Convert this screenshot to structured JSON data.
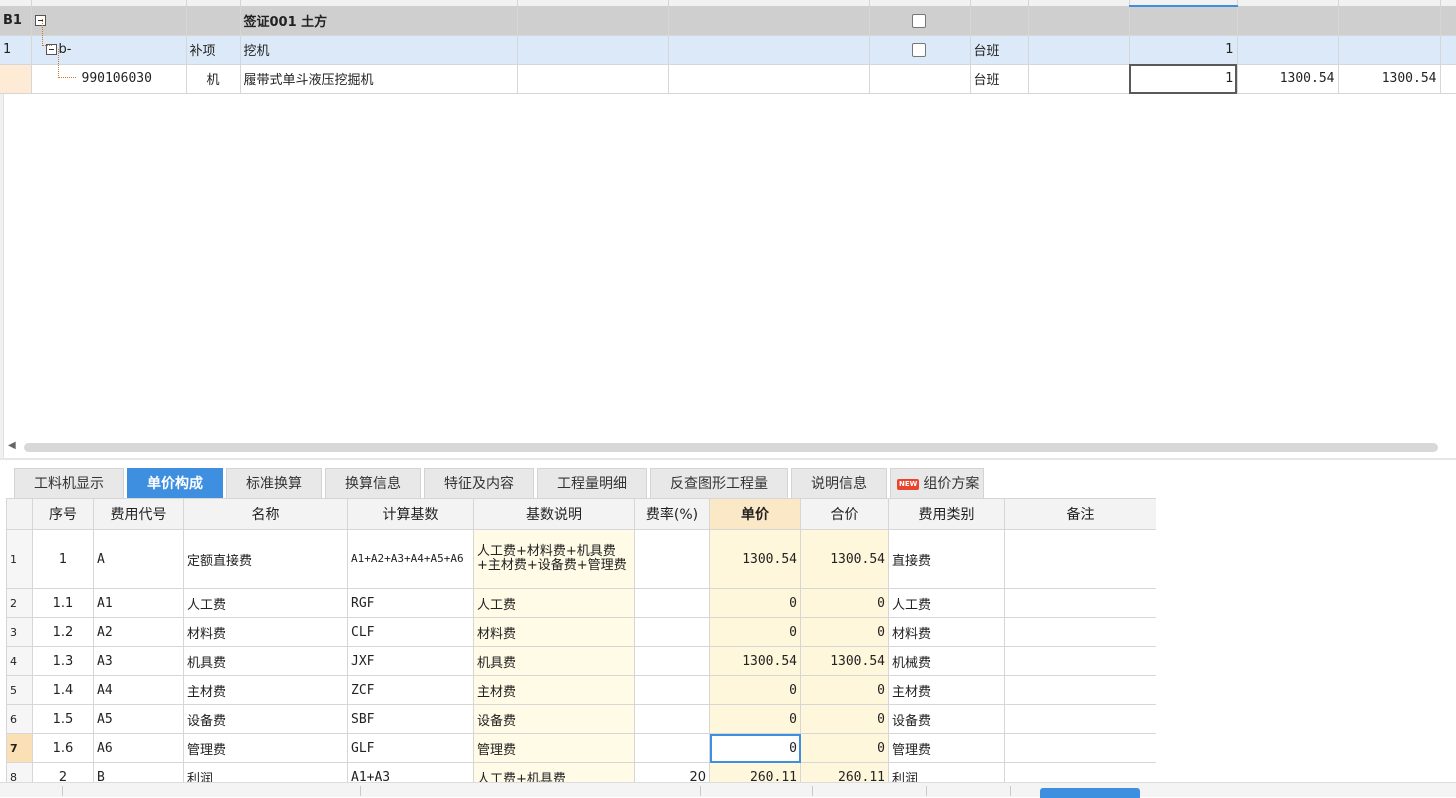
{
  "top_grid": {
    "rows": [
      {
        "row_no": "B1",
        "code": "",
        "type": "",
        "name": "签证001 土方",
        "unit": "",
        "qty": "",
        "price": "",
        "total": ""
      },
      {
        "row_no": "1",
        "code": "b-",
        "type": "补项",
        "name": "挖机",
        "unit": "台班",
        "qty": "1",
        "price": "",
        "total": ""
      },
      {
        "row_no": "",
        "code": "990106030",
        "type": "机",
        "name": "履带式单斗液压挖掘机",
        "unit": "台班",
        "qty": "1",
        "price": "1300.54",
        "total": "1300.54"
      }
    ]
  },
  "tabs": [
    {
      "label": "工料机显示"
    },
    {
      "label": "单价构成",
      "active": true
    },
    {
      "label": "标准换算"
    },
    {
      "label": "换算信息"
    },
    {
      "label": "特征及内容"
    },
    {
      "label": "工程量明细"
    },
    {
      "label": "反查图形工程量"
    },
    {
      "label": "说明信息"
    },
    {
      "label": "组价方案",
      "badge": "NEW"
    }
  ],
  "cost_table": {
    "headers": [
      "序号",
      "费用代号",
      "名称",
      "计算基数",
      "基数说明",
      "费率(%)",
      "单价",
      "合价",
      "费用类别",
      "备注"
    ],
    "rows": [
      {
        "rn": "1",
        "seq": "1",
        "code": "A",
        "name": "定额直接费",
        "base": "A1+A2+A3+A4+A5+A6",
        "desc": "人工费+材料费+机具费+主材费+设备费+管理费",
        "rate": "",
        "price": "1300.54",
        "total": "1300.54",
        "category": "直接费",
        "note": ""
      },
      {
        "rn": "2",
        "seq": "1.1",
        "code": "A1",
        "name": "人工费",
        "base": "RGF",
        "desc": "人工费",
        "rate": "",
        "price": "0",
        "total": "0",
        "category": "人工费",
        "note": ""
      },
      {
        "rn": "3",
        "seq": "1.2",
        "code": "A2",
        "name": "材料费",
        "base": "CLF",
        "desc": "材料费",
        "rate": "",
        "price": "0",
        "total": "0",
        "category": "材料费",
        "note": ""
      },
      {
        "rn": "4",
        "seq": "1.3",
        "code": "A3",
        "name": "机具费",
        "base": "JXF",
        "desc": "机具费",
        "rate": "",
        "price": "1300.54",
        "total": "1300.54",
        "category": "机械费",
        "note": ""
      },
      {
        "rn": "5",
        "seq": "1.4",
        "code": "A4",
        "name": "主材费",
        "base": "ZCF",
        "desc": "主材费",
        "rate": "",
        "price": "0",
        "total": "0",
        "category": "主材费",
        "note": ""
      },
      {
        "rn": "6",
        "seq": "1.5",
        "code": "A5",
        "name": "设备费",
        "base": "SBF",
        "desc": "设备费",
        "rate": "",
        "price": "0",
        "total": "0",
        "category": "设备费",
        "note": ""
      },
      {
        "rn": "7",
        "seq": "1.6",
        "code": "A6",
        "name": "管理费",
        "base": "GLF",
        "desc": "管理费",
        "rate": "",
        "price": "0",
        "total": "0",
        "category": "管理费",
        "note": ""
      },
      {
        "rn": "8",
        "seq": "2",
        "code": "B",
        "name": "利润",
        "base": "A1+A3",
        "desc": "人工费+机具费",
        "rate": "20",
        "price": "260.11",
        "total": "260.11",
        "category": "利润",
        "note": ""
      }
    ]
  }
}
